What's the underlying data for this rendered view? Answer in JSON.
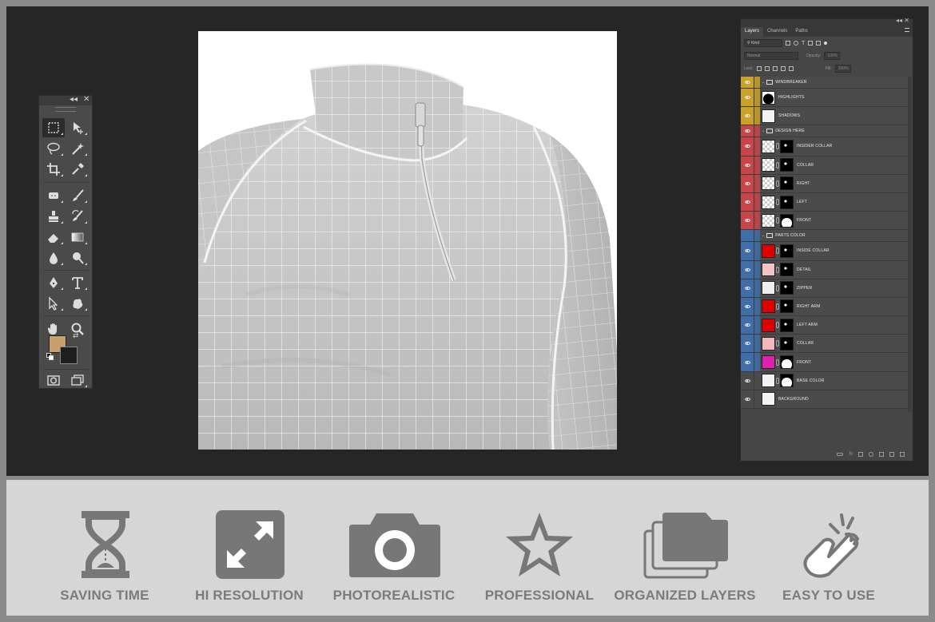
{
  "tools_panel": {
    "controls": {
      "collapse": "◂◂",
      "close": "✕"
    },
    "colors": {
      "foreground": "#c8a06e",
      "background": "#1e1e1e"
    }
  },
  "layers_panel": {
    "tabs": [
      "Layers",
      "Channels",
      "Paths"
    ],
    "filter_kind": "Kind",
    "blend_mode": "Normal",
    "opacity_label": "Opacity:",
    "opacity_value": "100%",
    "lock_label": "Lock:",
    "fill_label": "Fill:",
    "fill_value": "100%",
    "layers": [
      {
        "name": "WINDBREAKER",
        "type": "group",
        "color": "#c9a227",
        "visible": true
      },
      {
        "name": "HIGHLIGHTS",
        "type": "layer",
        "color": "#c9a227",
        "visible": true,
        "thumb": "black-shape"
      },
      {
        "name": "SHADOWS",
        "type": "layer",
        "color": "#c9a227",
        "visible": true,
        "thumb": "white"
      },
      {
        "name": "DESIGN HERE",
        "type": "group",
        "color": "#c8464a",
        "visible": true
      },
      {
        "name": "INSIDER COLLAR",
        "type": "smart",
        "color": "#c8464a",
        "visible": true
      },
      {
        "name": "COLLAR",
        "type": "smart",
        "color": "#c8464a",
        "visible": true
      },
      {
        "name": "RIGHT",
        "type": "smart",
        "color": "#c8464a",
        "visible": true
      },
      {
        "name": "LEFT",
        "type": "smart",
        "color": "#c8464a",
        "visible": true
      },
      {
        "name": "FRONT",
        "type": "smart",
        "color": "#c8464a",
        "visible": true
      },
      {
        "name": "PARTS COLOR",
        "type": "group",
        "color": "#3f6fa8",
        "visible": false
      },
      {
        "name": "INSIDE COLLAR",
        "type": "fill",
        "color": "#3f6fa8",
        "visible": true,
        "fill": "#e00000"
      },
      {
        "name": "DETAIL",
        "type": "fill",
        "color": "#3f6fa8",
        "visible": true,
        "fill": "#f3c4c4"
      },
      {
        "name": "ZIPPER",
        "type": "fill",
        "color": "#3f6fa8",
        "visible": true,
        "fill": "#eeeeee"
      },
      {
        "name": "RIGHT ARM",
        "type": "fill",
        "color": "#3f6fa8",
        "visible": true,
        "fill": "#e00000"
      },
      {
        "name": "LEFT ARM",
        "type": "fill",
        "color": "#3f6fa8",
        "visible": true,
        "fill": "#e00000"
      },
      {
        "name": "COLLAR",
        "type": "fill",
        "color": "#3f6fa8",
        "visible": true,
        "fill": "#f4b8bc"
      },
      {
        "name": "FRONT",
        "type": "fill",
        "color": "#3f6fa8",
        "visible": true,
        "fill": "#e020b0"
      },
      {
        "name": "BASE COLOR",
        "type": "fill",
        "color": "none",
        "visible": true,
        "fill": "#f2f2f2"
      },
      {
        "name": "BACKGROUND",
        "type": "layer",
        "color": "none",
        "visible": true,
        "thumb": "white"
      }
    ]
  },
  "features": [
    {
      "label": "SAVING TIME",
      "icon": "hourglass-icon"
    },
    {
      "label": "HI RESOLUTION",
      "icon": "expand-icon"
    },
    {
      "label": "PHOTOREALISTIC",
      "icon": "camera-icon"
    },
    {
      "label": "PROFESSIONAL",
      "icon": "star-icon"
    },
    {
      "label": "ORGANIZED LAYERS",
      "icon": "folders-icon"
    },
    {
      "label": "EASY TO USE",
      "icon": "pointing-hand-icon"
    }
  ],
  "theme": {
    "icon_gray": "#777777",
    "label_gray": "#7b7b7b"
  }
}
